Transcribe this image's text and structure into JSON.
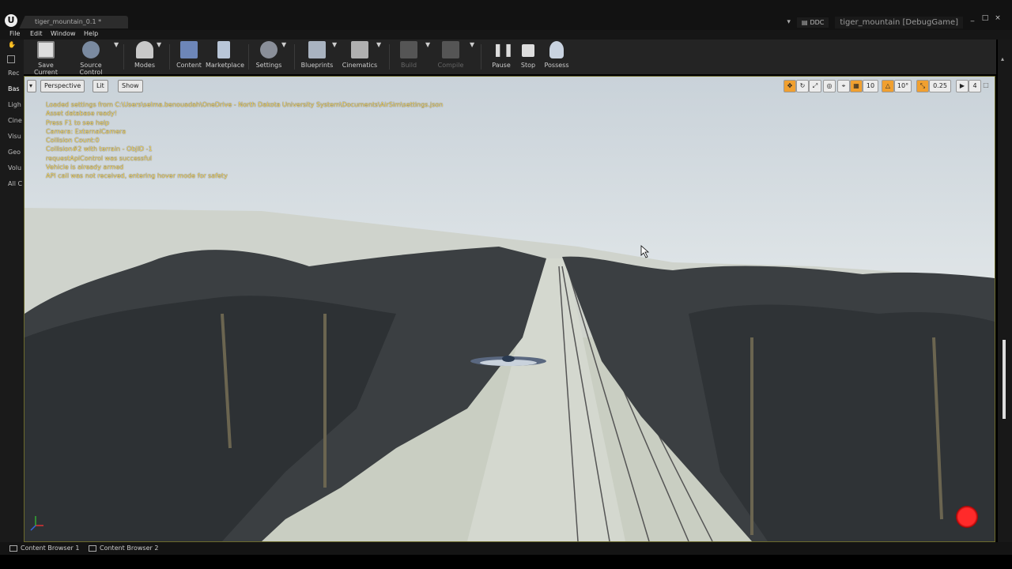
{
  "window": {
    "tab_title": "tiger_mountain_0.1 *",
    "ddc_label": "DDC",
    "project_name": "tiger_mountain [DebugGame]",
    "controls": [
      "_",
      "□",
      "×"
    ]
  },
  "menu": [
    "File",
    "Edit",
    "Window",
    "Help"
  ],
  "left_panel": [
    "Rec",
    "Bas",
    "Ligh",
    "Cine",
    "Visu",
    "Geo",
    "Volu",
    "All C"
  ],
  "toolbar": {
    "save_current": "Save Current",
    "source_control": "Source Control",
    "modes": "Modes",
    "content": "Content",
    "marketplace": "Marketplace",
    "settings": "Settings",
    "blueprints": "Blueprints",
    "cinematics": "Cinematics",
    "build": "Build",
    "compile": "Compile",
    "pause": "Pause",
    "stop": "Stop",
    "possess": "Possess"
  },
  "viewport": {
    "view_mode": "Perspective",
    "lighting": "Lit",
    "show": "Show",
    "grid_snap": "10",
    "rotate_snap": "10°",
    "scale_snap": "0.25",
    "camera_speed": "4",
    "log_lines": [
      "Loaded settings from C:\\Users\\selma.benouadah\\OneDrive - North Dakota University System\\Documents\\AirSim\\settings.json",
      "Asset database ready!",
      "Press F1 to see help",
      "Camera: ExternalCamera",
      "Collision Count:0",
      "Collision#2 with terrain - ObjID -1",
      "requestApiControl was successful",
      "Vehicle is already armed",
      "API call was not received, entering hover mode for safety"
    ]
  },
  "status": {
    "content_browser_1": "Content Browser 1",
    "content_browser_2": "Content Browser 2"
  },
  "colors": {
    "log_text": "#ffdf66",
    "record_button": "#e01010",
    "viewport_border": "#6c6a2c"
  }
}
